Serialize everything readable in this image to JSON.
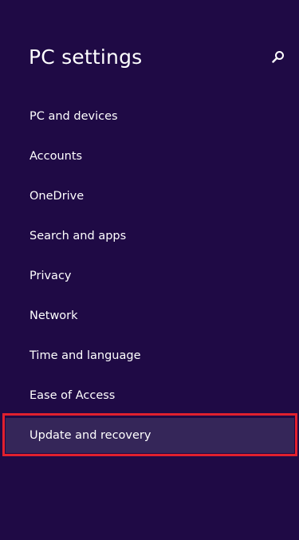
{
  "header": {
    "title": "PC settings",
    "search_icon": "search-icon"
  },
  "nav": {
    "items": [
      {
        "label": "PC and devices"
      },
      {
        "label": "Accounts"
      },
      {
        "label": "OneDrive"
      },
      {
        "label": "Search and apps"
      },
      {
        "label": "Privacy"
      },
      {
        "label": "Network"
      },
      {
        "label": "Time and language"
      },
      {
        "label": "Ease of Access"
      },
      {
        "label": "Update and recovery",
        "selected": true
      }
    ]
  },
  "colors": {
    "background": "#1f0a45",
    "selected_background": "#352659",
    "highlight_border": "#e0202e",
    "text": "#ffffff"
  }
}
